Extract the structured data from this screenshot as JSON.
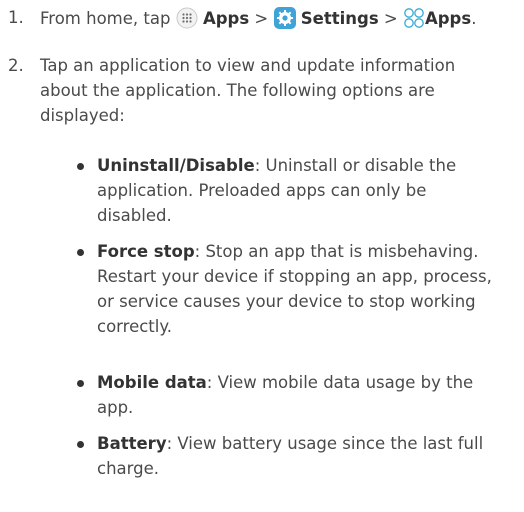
{
  "step1": {
    "number": "1.",
    "prefix": "From home, tap ",
    "apps_label": "Apps",
    "sep1": " > ",
    "settings_label": "Settings",
    "sep2": " > ",
    "apps2_label": "Apps",
    "end": "."
  },
  "step2": {
    "number": "2.",
    "lines": [
      "Tap an application to view and update information",
      "about the application. The following options are",
      "displayed:"
    ]
  },
  "options": [
    {
      "term": "Uninstall/Disable",
      "lines": [
        ": Uninstall or disable the",
        "application. Preloaded apps can only be",
        "disabled."
      ]
    },
    {
      "term": "Force stop",
      "lines": [
        ": Stop an app that is misbehaving.",
        "Restart your device if stopping an app, process,",
        "or service causes your device to stop working",
        "correctly."
      ]
    },
    {
      "term": "Mobile data",
      "lines": [
        ": View mobile data usage by the",
        "app."
      ]
    },
    {
      "term": "Battery",
      "lines": [
        ": View battery usage since the last full",
        "charge."
      ]
    }
  ],
  "colors": {
    "text": "#4a4a4a",
    "bold": "#333333",
    "settings_icon_bg": "#3fa3d8",
    "apps_outline_icon": "#35a9d6"
  },
  "icons": [
    "apps-grid-icon",
    "settings-gear-icon",
    "apps-circles-icon"
  ]
}
